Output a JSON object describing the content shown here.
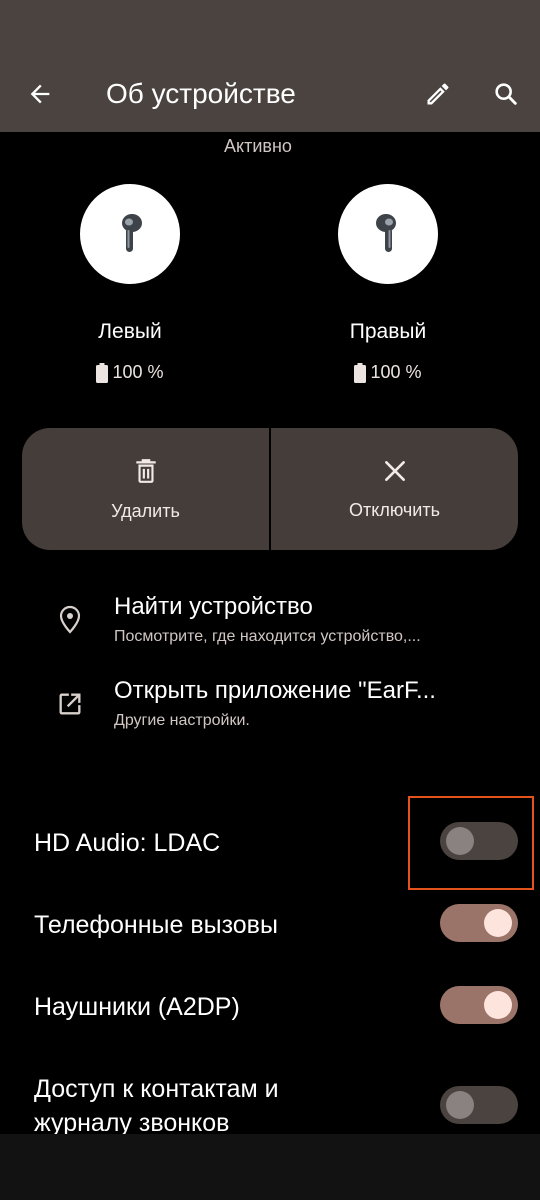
{
  "header": {
    "title": "Об устройстве"
  },
  "status": {
    "active_label": "Активно"
  },
  "earbuds": [
    {
      "label": "Левый",
      "battery": "100 %"
    },
    {
      "label": "Правый",
      "battery": "100 %"
    }
  ],
  "actions": {
    "delete_label": "Удалить",
    "disconnect_label": "Отключить"
  },
  "links": [
    {
      "title": "Найти устройство",
      "subtitle": "Посмотрите, где находится устройство,..."
    },
    {
      "title": "Открыть приложение \"EarF...",
      "subtitle": "Другие настройки."
    }
  ],
  "settings": [
    {
      "label": "HD Audio: LDAC",
      "enabled": false
    },
    {
      "label": "Телефонные вызовы",
      "enabled": true
    },
    {
      "label": "Наушники (A2DP)",
      "enabled": true
    },
    {
      "label_line1": "Доступ к контактам и",
      "label_line2": "журналу звонков",
      "enabled": false
    }
  ],
  "colors": {
    "appbar_bg": "#4a4340",
    "card_bg": "#443d3a",
    "switch_on_track": "#9b7469",
    "switch_on_thumb": "#fde4dc",
    "switch_off_track": "#4a4340",
    "highlight": "#e5531d"
  },
  "icons": [
    "arrow-back-icon",
    "pencil-icon",
    "search-icon",
    "earbud-icon",
    "battery-icon",
    "trash-icon",
    "close-icon",
    "location-pin-icon",
    "open-external-icon"
  ]
}
